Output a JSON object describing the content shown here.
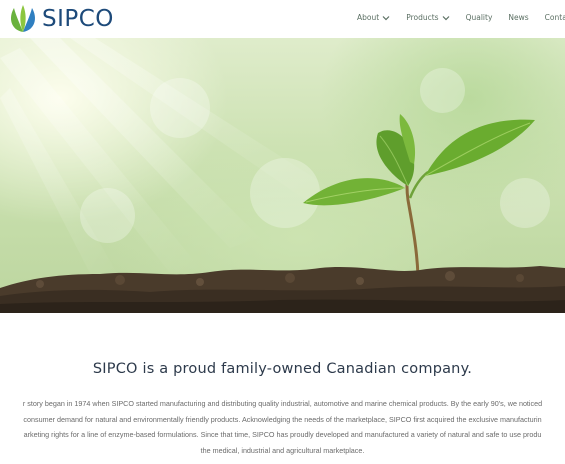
{
  "header": {
    "brand": "SIPCO",
    "nav": [
      {
        "label": "About",
        "dropdown": true
      },
      {
        "label": "Products",
        "dropdown": true
      },
      {
        "label": "Quality",
        "dropdown": false
      },
      {
        "label": "News",
        "dropdown": false
      },
      {
        "label": "Contact",
        "dropdown": false
      }
    ]
  },
  "hero": {
    "image": "seedling-sprouting-from-soil"
  },
  "main": {
    "headline": "SIPCO is a proud family-owned Canadian company.",
    "paragraph_lines": [
      "r story began in 1974 when SIPCO started manufacturing and distributing quality industrial, automotive and marine chemical products. By the early 90’s, we noticed",
      "consumer demand for natural and environmentally friendly products. Acknowledging the needs of the marketplace, SIPCO first acquired the exclusive manufacturin",
      "arketing rights for a line of enzyme-based formulations. Since that time, SIPCO has proudly developed and manufactured a variety of natural and safe to use produ",
      "the medical, industrial and agricultural marketplace."
    ]
  },
  "colors": {
    "brand": "#1d4a7a",
    "logo_green": "#6ab23e",
    "logo_blue": "#2f7fc0",
    "nav_text": "#5b6f63",
    "headline": "#2d3a4b",
    "body_text": "#6b6b6b"
  }
}
